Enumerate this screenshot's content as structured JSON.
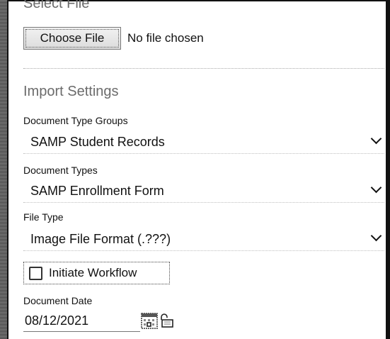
{
  "select_file": {
    "title": "Select File",
    "choose_button": "Choose File",
    "status": "No file chosen"
  },
  "import_settings": {
    "title": "Import Settings",
    "document_type_groups": {
      "label": "Document Type Groups",
      "value": "SAMP Student Records"
    },
    "document_types": {
      "label": "Document Types",
      "value": "SAMP Enrollment Form"
    },
    "file_type": {
      "label": "File Type",
      "value": "Image File Format (.???)"
    },
    "initiate_workflow": {
      "label": "Initiate Workflow",
      "checked": false
    },
    "document_date": {
      "label": "Document Date",
      "value": "08/12/2021"
    }
  },
  "icons": {
    "calendar": "calendar-icon",
    "lock": "unlock-icon",
    "dropdown": "chevron-down-icon"
  }
}
